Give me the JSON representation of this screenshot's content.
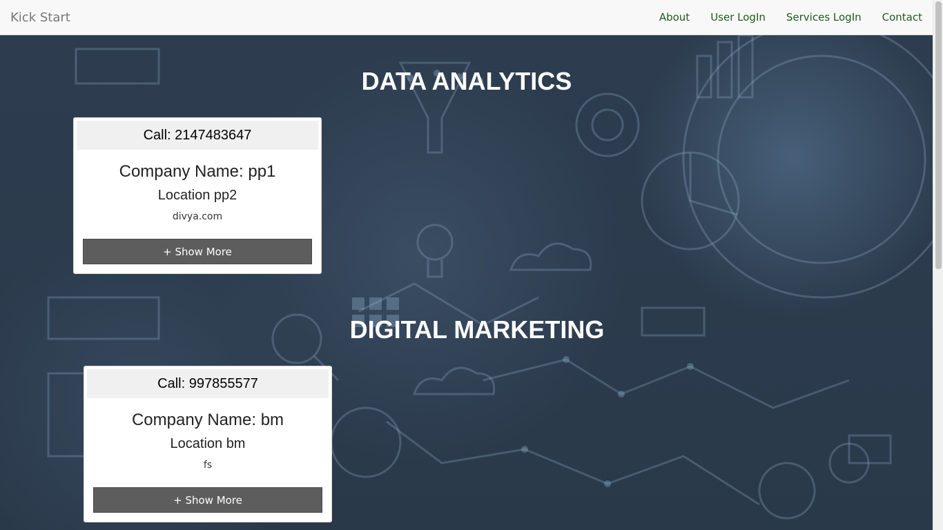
{
  "nav": {
    "brand": "Kick Start",
    "links": [
      "About",
      "User LogIn",
      "Services LogIn",
      "Contact"
    ]
  },
  "sections": [
    {
      "title": "DATA ANALYTICS",
      "card": {
        "call": "Call: 2147483647",
        "company": "Company Name: pp1",
        "location": "Location pp2",
        "site": "divya.com",
        "button": "+ Show More"
      }
    },
    {
      "title": "DIGITAL MARKETING",
      "card": {
        "call": "Call: 997855577",
        "company": "Company Name: bm",
        "location": "Location bm",
        "site": "fs",
        "button": "+ Show More"
      }
    }
  ],
  "colors": {
    "nav_link": "#1e5a1e",
    "background": "#2b3a4b",
    "button": "#5d5d5d"
  }
}
